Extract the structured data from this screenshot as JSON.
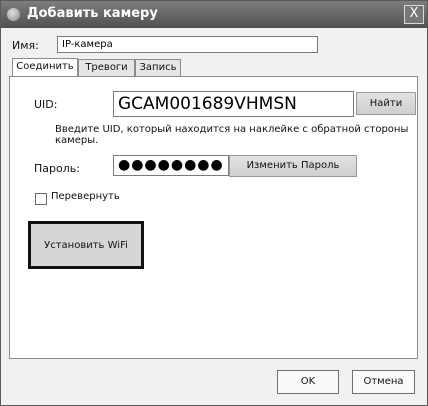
{
  "window": {
    "title": "Добавить камеру",
    "close_label": "X"
  },
  "name_field": {
    "label": "Имя:",
    "value": "IP-камера"
  },
  "tabs": [
    {
      "label": "Соединить",
      "active": true
    },
    {
      "label": "Тревоги",
      "active": false
    },
    {
      "label": "Запись",
      "active": false
    }
  ],
  "connect": {
    "uid_label": "UID:",
    "uid_value": "GCAM001689VHMSN",
    "find_button": "Найти",
    "hint": "Введите UID, который находится на наклейке с обратной стороны камеры.",
    "password_label": "Пароль:",
    "password_value": "●●●●●●●●",
    "change_password_button": "Изменить Пароль",
    "flip_label": "Перевернуть",
    "flip_checked": false,
    "wifi_button": "Установить WiFi"
  },
  "footer": {
    "ok_button": "OK",
    "cancel_button": "Отмена"
  }
}
